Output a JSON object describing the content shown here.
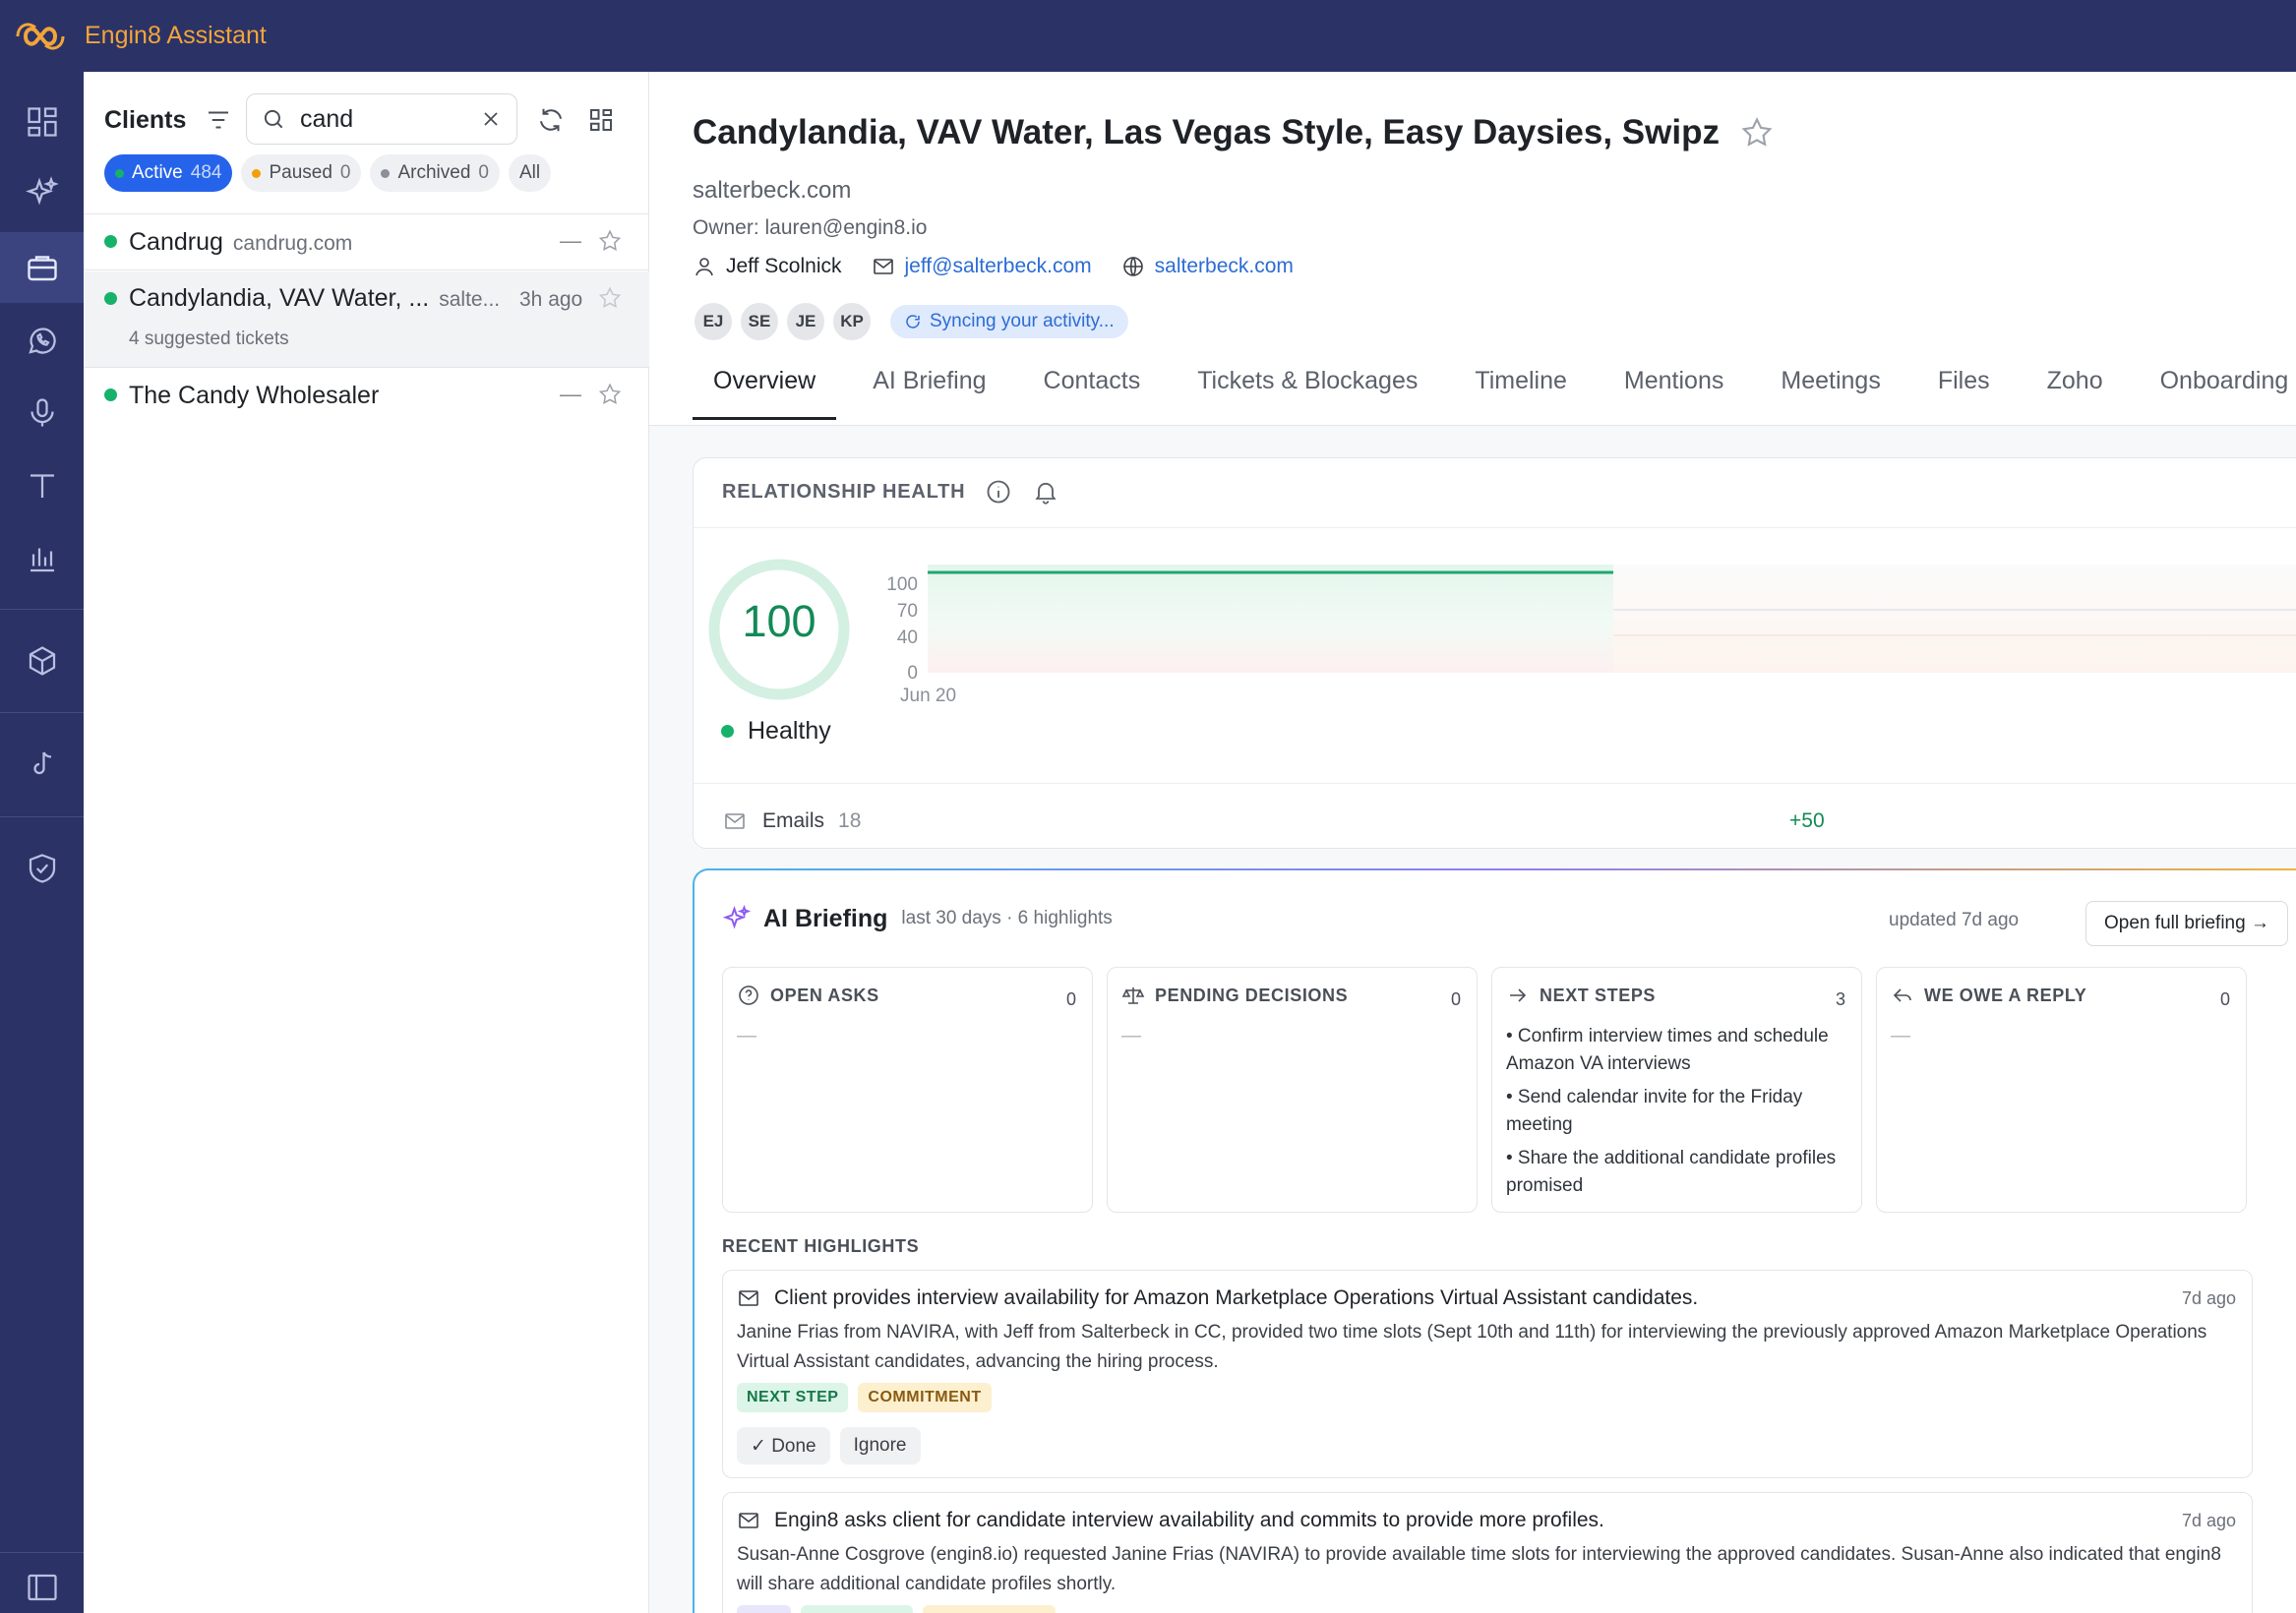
{
  "app": {
    "title": "Engin8 Assistant",
    "brand_color": "#f2a53a",
    "nav_bg": "#2b3266"
  },
  "rail": {
    "icons": [
      "dashboard-icon",
      "sparkles-icon",
      "briefcase-icon",
      "whatsapp-icon",
      "microphone-icon",
      "text-tool-icon",
      "bar-chart-icon",
      "cube-icon",
      "tiktok-icon",
      "shield-check-icon",
      "sidebar-toggle-icon"
    ]
  },
  "clients": {
    "title": "Clients",
    "search_value": "cand",
    "filters": [
      {
        "label": "Active",
        "count": "484",
        "dot": "#17b26a"
      },
      {
        "label": "Paused",
        "count": "0",
        "dot": "#f59e0b"
      },
      {
        "label": "Archived",
        "count": "0",
        "dot": "#8a8f98"
      },
      {
        "label": "All",
        "count": ""
      }
    ],
    "items": [
      {
        "name": "Candrug",
        "domain": "candrug.com",
        "dash": "—"
      },
      {
        "name": "Candylandia, VAV Water, ...",
        "domain": "salte...",
        "time": "3h ago",
        "sub": "4 suggested tickets"
      },
      {
        "name": "The Candy Wholesaler",
        "domain": "",
        "dash": "—"
      }
    ]
  },
  "header": {
    "title": "Candylandia, VAV Water, Las Vegas Style, Easy Daysies, Swipz",
    "domain": "salterbeck.com",
    "owner": "Owner: lauren@engin8.io",
    "contact_name": "Jeff Scolnick",
    "contact_email": "jeff@salterbeck.com",
    "contact_site": "salterbeck.com",
    "avatars": [
      "EJ",
      "SE",
      "JE",
      "KP"
    ],
    "sync": "Syncing your activity...",
    "tabs": [
      "Overview",
      "AI Briefing",
      "Contacts",
      "Tickets & Blockages",
      "Timeline",
      "Mentions",
      "Meetings",
      "Files",
      "Zoho",
      "Onboarding"
    ]
  },
  "health": {
    "title": "RELATIONSHIP HEALTH",
    "score": "100",
    "status": "Healthy",
    "y_ticks": [
      "100",
      "70",
      "40",
      "0"
    ],
    "x_tick": "Jun 20",
    "emails_label": "Emails",
    "emails_count": "18",
    "delta": "+50",
    "series_value": 100
  },
  "briefing": {
    "title": "AI Briefing",
    "meta": "last 30 days · 6 highlights",
    "updated": "updated 7d ago",
    "open_label": "Open full briefing →",
    "cards": [
      {
        "title": "OPEN ASKS",
        "count": "0",
        "empty": "—"
      },
      {
        "title": "PENDING DECISIONS",
        "count": "0",
        "empty": "—"
      },
      {
        "title": "NEXT STEPS",
        "count": "3",
        "items": [
          "• Confirm interview times and schedule Amazon VA interviews",
          "• Send calendar invite for the Friday meeting",
          "• Share the additional candidate profiles promised"
        ]
      },
      {
        "title": "WE OWE A REPLY",
        "count": "0",
        "empty": "—"
      }
    ],
    "recent_label": "RECENT HIGHLIGHTS",
    "highlights": [
      {
        "title": "Client provides interview availability for Amazon Marketplace Operations Virtual Assistant candidates.",
        "time": "7d ago",
        "body": "Janine Frias from NAVIRA, with Jeff from Salterbeck in CC, provided two time slots (Sept 10th and 11th) for interviewing the previously approved Amazon Marketplace Operations Virtual Assistant candidates, advancing the hiring process.",
        "tags": [
          "NEXT STEP",
          "COMMITMENT"
        ],
        "done": "✓ Done",
        "ignore": "Ignore"
      },
      {
        "title": "Engin8 asks client for candidate interview availability and commits to provide more profiles.",
        "time": "7d ago",
        "body": "Susan-Anne Cosgrove (engin8.io) requested Janine Frias (NAVIRA) to provide available time slots for interviewing the approved candidates. Susan-Anne also indicated that engin8 will share additional candidate profiles shortly.",
        "tags": [
          "ASK",
          "NEXT STEP",
          "COMMITMENT"
        ]
      }
    ]
  }
}
